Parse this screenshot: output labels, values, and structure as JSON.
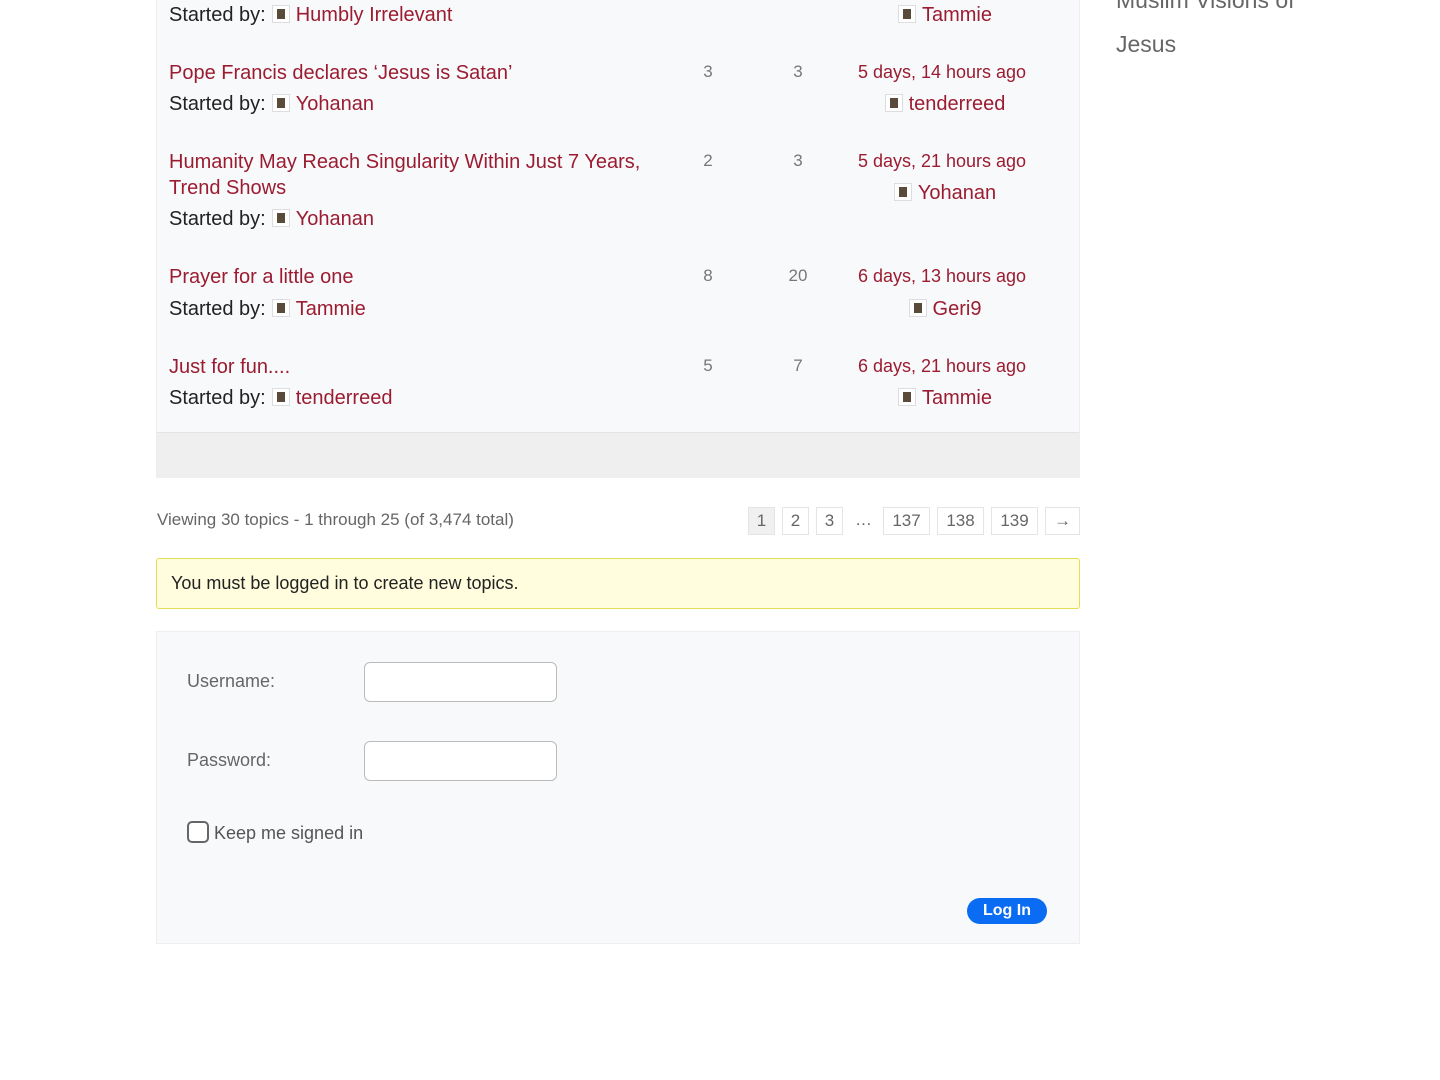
{
  "topics": [
    {
      "started_by_label": "Started by:",
      "author": "Humbly Irrelevant",
      "last_author": "Tammie"
    },
    {
      "title": "Pope Francis declares ‘Jesus is Satan’",
      "voices": "3",
      "posts": "3",
      "freshness": "5 days, 14 hours ago",
      "started_by_label": "Started by:",
      "author": "Yohanan",
      "last_author": "tenderreed"
    },
    {
      "title": "Humanity May Reach Singularity Within Just 7 Years, Trend Shows",
      "voices": "2",
      "posts": "3",
      "freshness": "5 days, 21 hours ago",
      "started_by_label": "Started by:",
      "author": "Yohanan",
      "last_author": "Yohanan"
    },
    {
      "title": "Prayer for a little one",
      "voices": "8",
      "posts": "20",
      "freshness": "6 days, 13 hours ago",
      "started_by_label": "Started by:",
      "author": "Tammie",
      "last_author": "Geri9"
    },
    {
      "title": "Just for fun....",
      "voices": "5",
      "posts": "7",
      "freshness": "6 days, 21 hours ago",
      "started_by_label": "Started by:",
      "author": "tenderreed",
      "last_author": "Tammie"
    }
  ],
  "pagination": {
    "count": "Viewing 30 topics - 1 through 25 (of 3,474 total)",
    "pages": [
      "1",
      "2",
      "3",
      "…",
      "137",
      "138",
      "139",
      "→"
    ],
    "current": "1"
  },
  "notice": "You must be logged in to create new topics.",
  "login": {
    "username_label": "Username:",
    "password_label": "Password:",
    "remember_label": "Keep me signed in",
    "submit": "Log In"
  },
  "sidebar": {
    "item": "Muslim Visions of Jesus",
    "accent": "#9b1c31"
  }
}
